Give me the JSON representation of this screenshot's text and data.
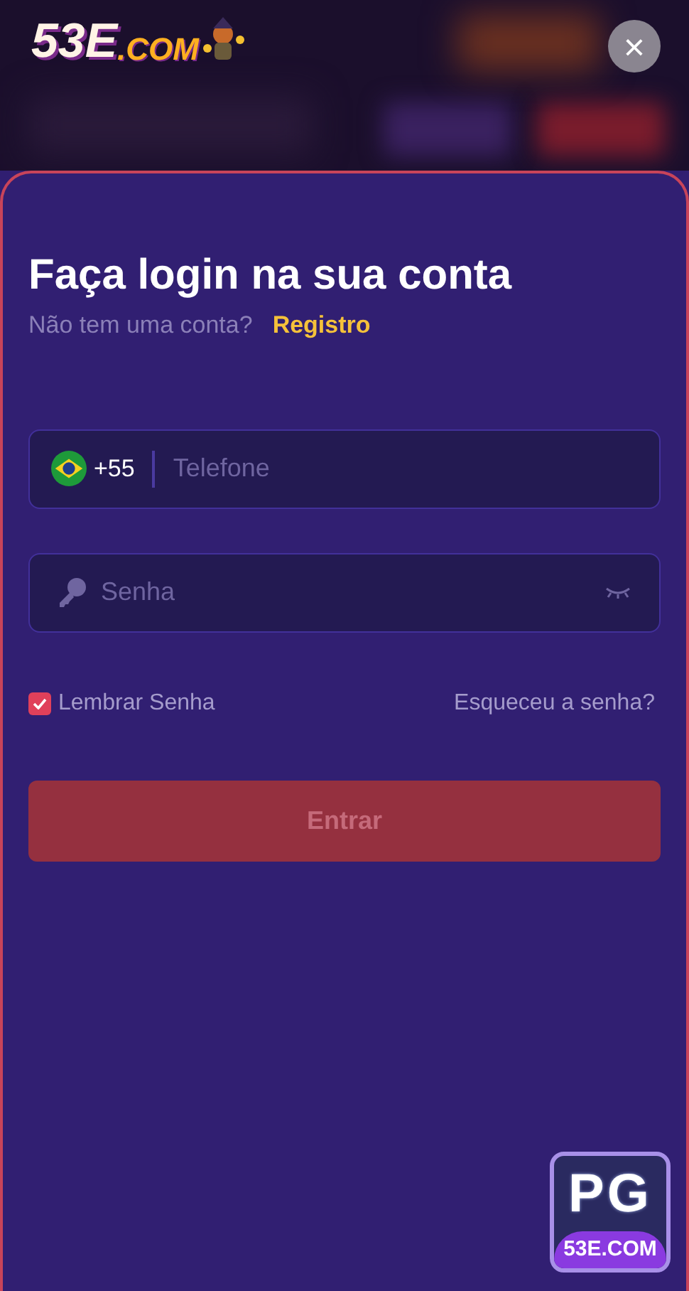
{
  "logo": {
    "brand": "53E",
    "suffix": ".COM"
  },
  "close_button": {
    "label": "×"
  },
  "title": "Faça login na sua conta",
  "subtitle": {
    "text": "Não tem uma conta?",
    "link": "Registro"
  },
  "phone_field": {
    "country_code": "+55",
    "placeholder": "Telefone"
  },
  "password_field": {
    "placeholder": "Senha"
  },
  "remember": {
    "label": "Lembrar Senha",
    "checked": true
  },
  "forgot_link": "Esqueceu a senha?",
  "submit": {
    "label": "Entrar",
    "disabled": true
  },
  "badge": {
    "top": "PG",
    "bottom": "53E.COM"
  }
}
